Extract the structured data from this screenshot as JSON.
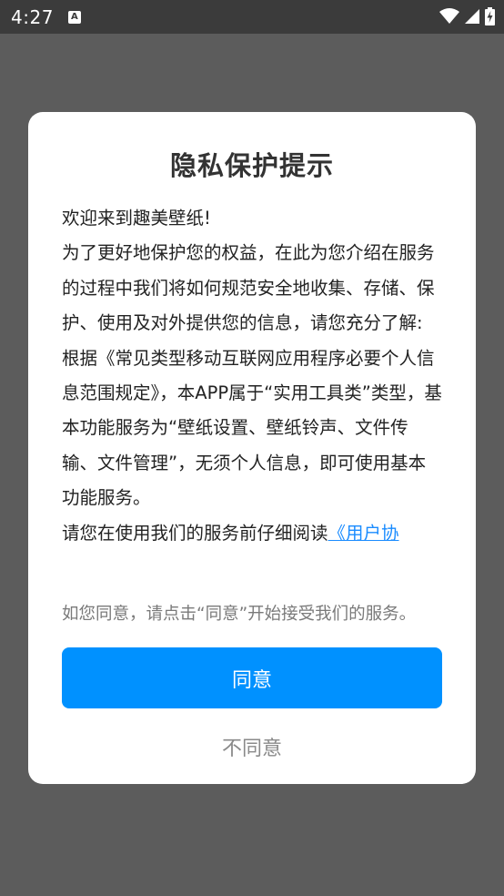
{
  "status_bar": {
    "time": "4:27",
    "notification_icon": "a-letter-icon",
    "icons": [
      "wifi-icon",
      "signal-icon",
      "battery-charging-icon"
    ]
  },
  "dialog": {
    "title": "隐私保护提示",
    "body_lines": [
      "欢迎来到趣美壁纸!",
      "为了更好地保护您的权益，在此为您介绍在服务的过程中我们将如何规范安全地收集、存储、保护、使用及对外提供您的信息，请您充分了解:",
      "根据《常见类型移动互联网应用程序必要个人信息范围规定》，本APP属于“实用工具类”类型，基本功能服务为“壁纸设置、壁纸铃声、文件传输、文件管理”，无须个人信息，即可使用基本功能服务。"
    ],
    "read_prefix": "请您在使用我们的服务前仔细阅读",
    "read_link": "《用户协",
    "consent_text": "如您同意，请点击“同意”开始接受我们的服务。",
    "agree_label": "同意",
    "disagree_label": "不同意"
  },
  "colors": {
    "accent": "#0091ff",
    "link": "#1a8cff",
    "overlay": "#5c5c5c",
    "status_bar": "#3b3b3b"
  }
}
